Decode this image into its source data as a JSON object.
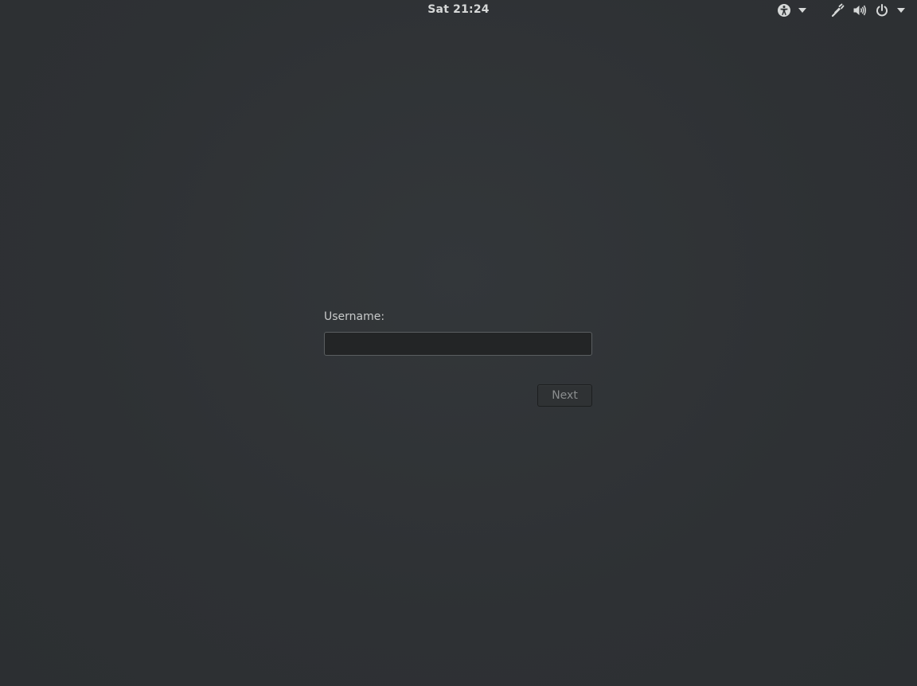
{
  "topbar": {
    "clock": "Sat 21:24",
    "indicators": {
      "accessibility": "accessibility-icon",
      "accessibility_menu": "chevron-down-icon",
      "network": "network-wired-icon",
      "volume": "volume-icon",
      "power": "power-icon",
      "system_menu": "chevron-down-icon"
    }
  },
  "login": {
    "username_label": "Username:",
    "username_value": "",
    "next_label": "Next"
  },
  "colors": {
    "background": "#2e3134",
    "text": "#d6d8d8",
    "input_bg": "#232526",
    "button_text_disabled": "#8a8d8e"
  }
}
